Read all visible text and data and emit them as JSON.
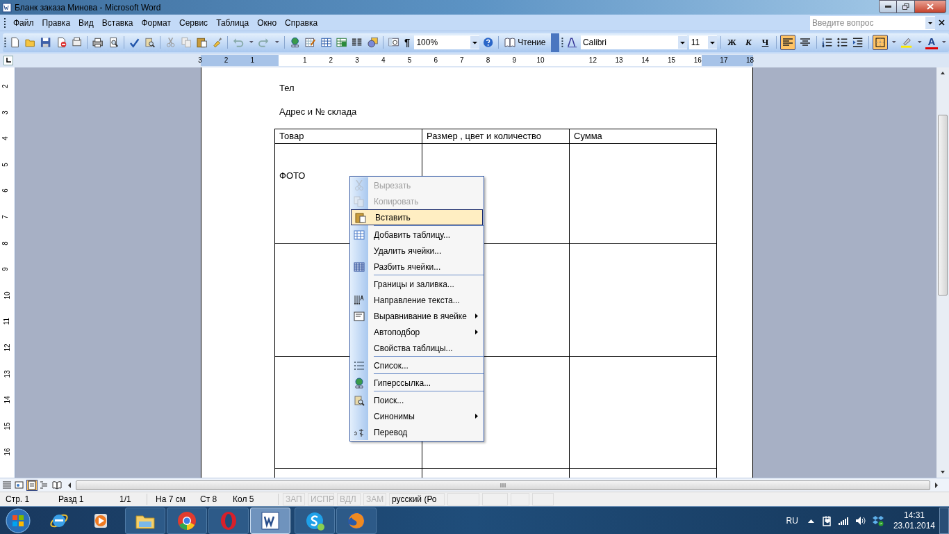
{
  "window": {
    "title": "Бланк заказа Минова - Microsoft Word"
  },
  "menu_bar": [
    "Файл",
    "Правка",
    "Вид",
    "Вставка",
    "Формат",
    "Сервис",
    "Таблица",
    "Окно",
    "Справка"
  ],
  "help_field": {
    "placeholder": "Введите вопрос"
  },
  "standard_toolbar": {
    "pilcrow": "¶",
    "zoom": "100%",
    "reading_button": "Чтение"
  },
  "formatting_toolbar": {
    "font": "Calibri",
    "size": "11",
    "style_buttons": [
      {
        "label": "Ж",
        "selected": false
      },
      {
        "label": "К",
        "selected": false
      },
      {
        "label": "Ч",
        "selected": false
      }
    ],
    "align_buttons": [
      {
        "selected": true
      },
      {
        "selected": false
      }
    ],
    "borders_button": {
      "selected": true
    },
    "font_color_button": "A"
  },
  "horizontal_ruler": [
    "3",
    "2",
    "1",
    "1",
    "2",
    "3",
    "4",
    "5",
    "6",
    "7",
    "8",
    "9",
    "10",
    "12",
    "13",
    "14",
    "15",
    "16",
    "17",
    "18"
  ],
  "vertical_ruler": [
    "2",
    "3",
    "4",
    "5",
    "6",
    "7",
    "8",
    "9",
    "10",
    "11",
    "12",
    "13",
    "14",
    "15",
    "16"
  ],
  "document": {
    "paragraphs": [
      "Тел",
      "Адрес и № склада"
    ],
    "table": {
      "columns": [
        "Товар",
        "Размер , цвет и количество",
        "Сумма"
      ],
      "rows": [
        [
          "ФОТО",
          "",
          ""
        ],
        [
          "",
          "",
          ""
        ],
        [
          "",
          "",
          ""
        ],
        [
          "",
          "",
          ""
        ]
      ]
    }
  },
  "context_menu": [
    {
      "label": "Вырезать",
      "disabled": true,
      "selected": false,
      "separator_before": false,
      "submenu": false
    },
    {
      "label": "Копировать",
      "disabled": true,
      "selected": false,
      "separator_before": false,
      "submenu": false
    },
    {
      "label": "Вставить",
      "disabled": false,
      "selected": true,
      "separator_before": false,
      "submenu": false
    },
    {
      "label": "Добавить таблицу...",
      "disabled": false,
      "selected": false,
      "separator_before": true,
      "submenu": false
    },
    {
      "label": "Удалить ячейки...",
      "disabled": false,
      "selected": false,
      "separator_before": false,
      "submenu": false
    },
    {
      "label": "Разбить ячейки...",
      "disabled": false,
      "selected": false,
      "separator_before": false,
      "submenu": false
    },
    {
      "label": "Границы и заливка...",
      "disabled": false,
      "selected": false,
      "separator_before": true,
      "submenu": false
    },
    {
      "label": "Направление текста...",
      "disabled": false,
      "selected": false,
      "separator_before": false,
      "submenu": false
    },
    {
      "label": "Выравнивание в ячейке",
      "disabled": false,
      "selected": false,
      "separator_before": false,
      "submenu": true
    },
    {
      "label": "Автоподбор",
      "disabled": false,
      "selected": false,
      "separator_before": false,
      "submenu": true
    },
    {
      "label": "Свойства таблицы...",
      "disabled": false,
      "selected": false,
      "separator_before": false,
      "submenu": false
    },
    {
      "label": "Список...",
      "disabled": false,
      "selected": false,
      "separator_before": true,
      "submenu": false
    },
    {
      "label": "Гиперссылка...",
      "disabled": false,
      "selected": false,
      "separator_before": true,
      "submenu": false
    },
    {
      "label": "Поиск...",
      "disabled": false,
      "selected": false,
      "separator_before": true,
      "submenu": false
    },
    {
      "label": "Синонимы",
      "disabled": false,
      "selected": false,
      "separator_before": false,
      "submenu": true
    },
    {
      "label": "Перевод",
      "disabled": false,
      "selected": false,
      "separator_before": false,
      "submenu": false
    }
  ],
  "view_buttons": [
    {
      "selected": false
    },
    {
      "selected": false
    },
    {
      "selected": true
    },
    {
      "selected": false
    },
    {
      "selected": false
    }
  ],
  "status_bar": [
    {
      "text": "Стр. 1",
      "kind": "plain",
      "disabled": false
    },
    {
      "text": "Разд 1",
      "kind": "plain",
      "disabled": false
    },
    {
      "text": "1/1",
      "kind": "plain",
      "disabled": false
    },
    {
      "text": "На 7 см",
      "kind": "plain",
      "disabled": false
    },
    {
      "text": "Ст 8",
      "kind": "plain",
      "disabled": false
    },
    {
      "text": "Кол 5",
      "kind": "plain",
      "disabled": false
    },
    {
      "text": "ЗАП",
      "kind": "box",
      "disabled": true
    },
    {
      "text": "ИСПР",
      "kind": "box",
      "disabled": true
    },
    {
      "text": "ВДЛ",
      "kind": "box",
      "disabled": true
    },
    {
      "text": "ЗАМ",
      "kind": "box",
      "disabled": true
    },
    {
      "text": "русский (Ро",
      "kind": "box",
      "disabled": false
    }
  ],
  "taskbar": {
    "apps": [
      {
        "selected": false
      },
      {
        "selected": false
      },
      {
        "selected": false
      },
      {
        "selected": false
      },
      {
        "selected": false
      },
      {
        "selected": true
      },
      {
        "selected": false
      },
      {
        "selected": false
      }
    ],
    "language": "RU",
    "time": "14:31",
    "date": "23.01.2014"
  }
}
